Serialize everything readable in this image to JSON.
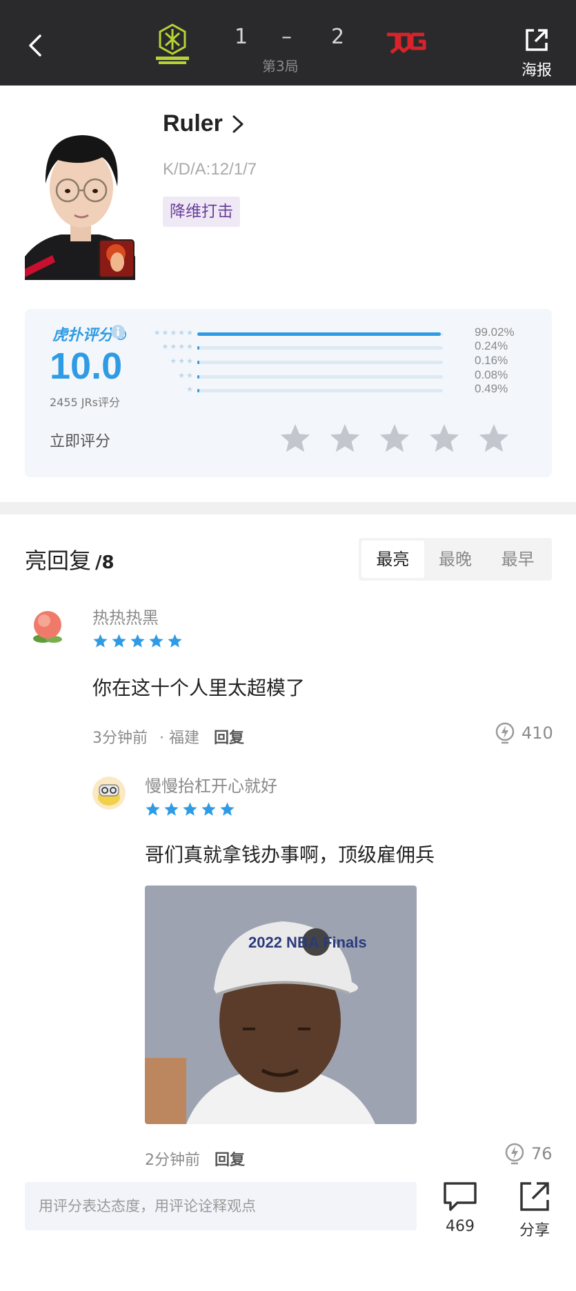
{
  "header": {
    "score_left": "1",
    "score_dash": "–",
    "score_right": "2",
    "game_label": "第3局",
    "poster_label": "海报"
  },
  "player": {
    "name": "Ruler",
    "kda": "K/D/A:12/1/7",
    "tag": "降维打击"
  },
  "rating": {
    "brand": "虎扑评分®",
    "score": "10.0",
    "count_label": "2455 JRs评分",
    "rate_now_label": "立即评分",
    "distribution": [
      {
        "stars": 5,
        "percent_label": "99.02%",
        "fraction": 0.9902
      },
      {
        "stars": 4,
        "percent_label": "0.24%",
        "fraction": 0.0024
      },
      {
        "stars": 3,
        "percent_label": "0.16%",
        "fraction": 0.0016
      },
      {
        "stars": 2,
        "percent_label": "0.08%",
        "fraction": 0.0008
      },
      {
        "stars": 1,
        "percent_label": "0.49%",
        "fraction": 0.0049
      }
    ],
    "accent_color": "#2f9be4"
  },
  "replies": {
    "title": "亮回复",
    "count": "/8",
    "sort_tabs": [
      {
        "label": "最亮",
        "active": true
      },
      {
        "label": "最晚",
        "active": false
      },
      {
        "label": "最早",
        "active": false
      }
    ],
    "items": [
      {
        "username": "热热热黑",
        "rating": 5,
        "text": "你在这十个人里太超模了",
        "time": "3分钟前",
        "location": "· 福建",
        "reply_label": "回复",
        "likes": "410"
      },
      {
        "username": "慢慢抬杠开心就好",
        "rating": 5,
        "text": "哥们真就拿钱办事啊，顶级雇佣兵",
        "time": "2分钟前",
        "reply_label": "回复",
        "likes": "76",
        "image_caption": "2022 NBA Finals"
      }
    ]
  },
  "bottom_bar": {
    "input_placeholder": "用评分表达态度，用评论诠释观点",
    "comment_count": "469",
    "share_label": "分享"
  }
}
